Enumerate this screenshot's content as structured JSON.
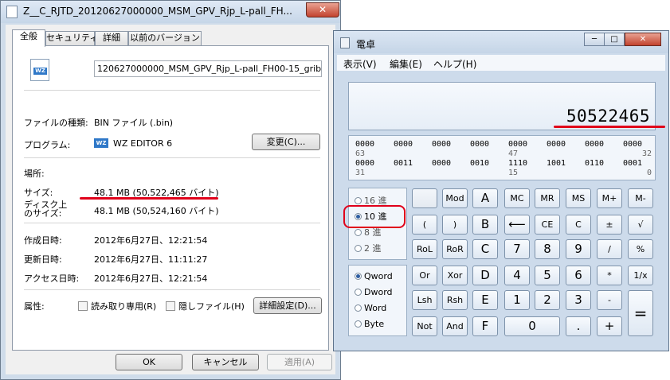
{
  "properties": {
    "title": "Z__C_RJTD_20120627000000_MSM_GPV_Rjp_L-pall_FH...",
    "close": "✕",
    "tabs": [
      "全般",
      "セキュリティ",
      "詳細",
      "以前のバージョン"
    ],
    "filename": "120627000000_MSM_GPV_Rjp_L-pall_FH00-15_grib2.bin",
    "file_icon_text": "WZ",
    "rows": {
      "type_label": "ファイルの種類:",
      "type_value": "BIN ファイル (.bin)",
      "program_label": "プログラム:",
      "program_value": "WZ EDITOR 6",
      "program_icon": "WZ",
      "change_button": "変更(C)...",
      "location_label": "場所:",
      "size_label": "サイズ:",
      "size_value": "48.1 MB (50,522,465 バイト)",
      "disk_label_1": "ディスク上",
      "disk_label_2": "のサイズ:",
      "disk_value": "48.1 MB (50,524,160 バイト)",
      "created_label": "作成日時:",
      "created_value": "2012年6月27日、12:21:54",
      "modified_label": "更新日時:",
      "modified_value": "2012年6月27日、11:11:27",
      "accessed_label": "アクセス日時:",
      "accessed_value": "2012年6月27日、12:21:54",
      "attr_label": "属性:",
      "readonly": "読み取り専用(R)",
      "hidden": "隠しファイル(H)",
      "advanced_button": "詳細設定(D)..."
    },
    "buttons": {
      "ok": "OK",
      "cancel": "キャンセル",
      "apply": "適用(A)"
    }
  },
  "calculator": {
    "title": "電卓",
    "window_buttons": {
      "minimize": "─",
      "maximize": "□",
      "close": "✕"
    },
    "menu": [
      "表示(V)",
      "編集(E)",
      "ヘルプ(H)"
    ],
    "display": "50522465",
    "bits": {
      "row1": [
        "0000",
        "0000",
        "0000",
        "0000",
        "0000",
        "0000",
        "0000",
        "0000"
      ],
      "row1_pos": [
        "63",
        "47",
        "32"
      ],
      "row2": [
        "0000",
        "0011",
        "0000",
        "0010",
        "1110",
        "1001",
        "0110",
        "0001"
      ],
      "row2_pos": [
        "31",
        "15",
        "0"
      ]
    },
    "base": [
      "16 進",
      "10 進",
      "8 進",
      "2 進"
    ],
    "word": [
      "Qword",
      "Dword",
      "Word",
      "Byte"
    ],
    "keys": {
      "r1": [
        "",
        "Mod",
        "A",
        "MC",
        "MR",
        "MS",
        "M+",
        "M-"
      ],
      "r2": [
        "(",
        ")",
        "B",
        "⟵",
        "CE",
        "C",
        "±",
        "√"
      ],
      "r3": [
        "RoL",
        "RoR",
        "C",
        "7",
        "8",
        "9",
        "/",
        "%"
      ],
      "r4": [
        "Or",
        "Xor",
        "D",
        "4",
        "5",
        "6",
        "*",
        "1/x"
      ],
      "r5": [
        "Lsh",
        "Rsh",
        "E",
        "1",
        "2",
        "3",
        "-",
        "="
      ],
      "r6": [
        "Not",
        "And",
        "F",
        "0",
        ".",
        "+"
      ]
    }
  }
}
